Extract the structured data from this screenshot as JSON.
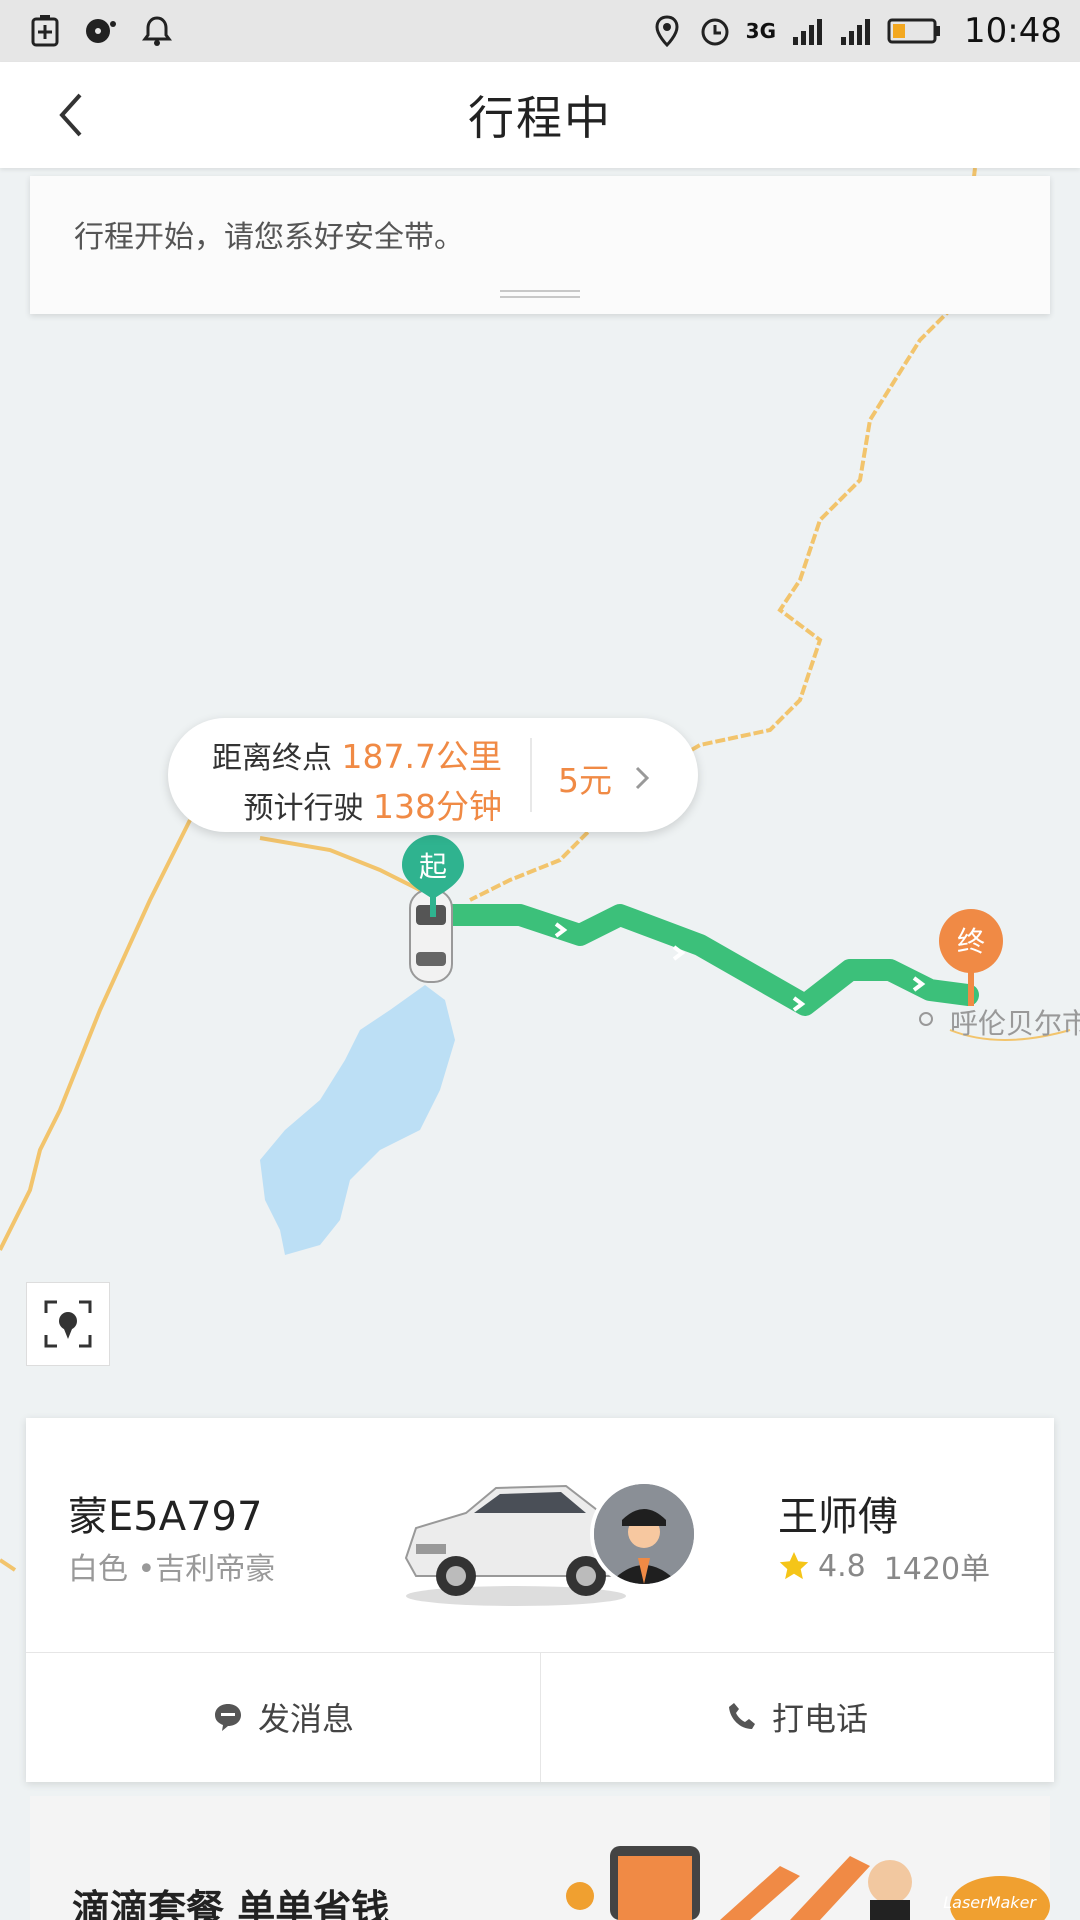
{
  "status_bar": {
    "network": "3G",
    "time": "10:48",
    "icons": [
      "battery-saver-icon",
      "music-icon",
      "notification-bell-icon",
      "location-icon",
      "alarm-icon",
      "signal-3g-icon",
      "signal-icon",
      "battery-icon"
    ]
  },
  "header": {
    "title": "行程中",
    "back_icon": "back-chevron-icon"
  },
  "notice": {
    "text": "行程开始，请您系好安全带。"
  },
  "trip_info": {
    "distance_label": "距离终点",
    "distance_value": "187.7公里",
    "time_label": "预计行驶",
    "time_value": "138分钟",
    "price": "5元"
  },
  "map": {
    "start_label": "起",
    "end_label": "终",
    "city_label": "呼伦贝尔市",
    "route_color": "#3cc07a",
    "boundary_color": "#f2c46c",
    "water_color": "#bcdff5"
  },
  "driver_card": {
    "plate": "蒙E5A797",
    "car_desc": "白色 •吉利帝豪",
    "driver_name": "王师傅",
    "rating": "4.8",
    "orders": "1420单",
    "message_label": "发消息",
    "call_label": "打电话"
  },
  "promo": {
    "text": "滴滴套餐 单单省钱",
    "watermark": "LaserMaker"
  },
  "colors": {
    "accent_orange": "#f08a45",
    "accent_green": "#3cb99a"
  }
}
